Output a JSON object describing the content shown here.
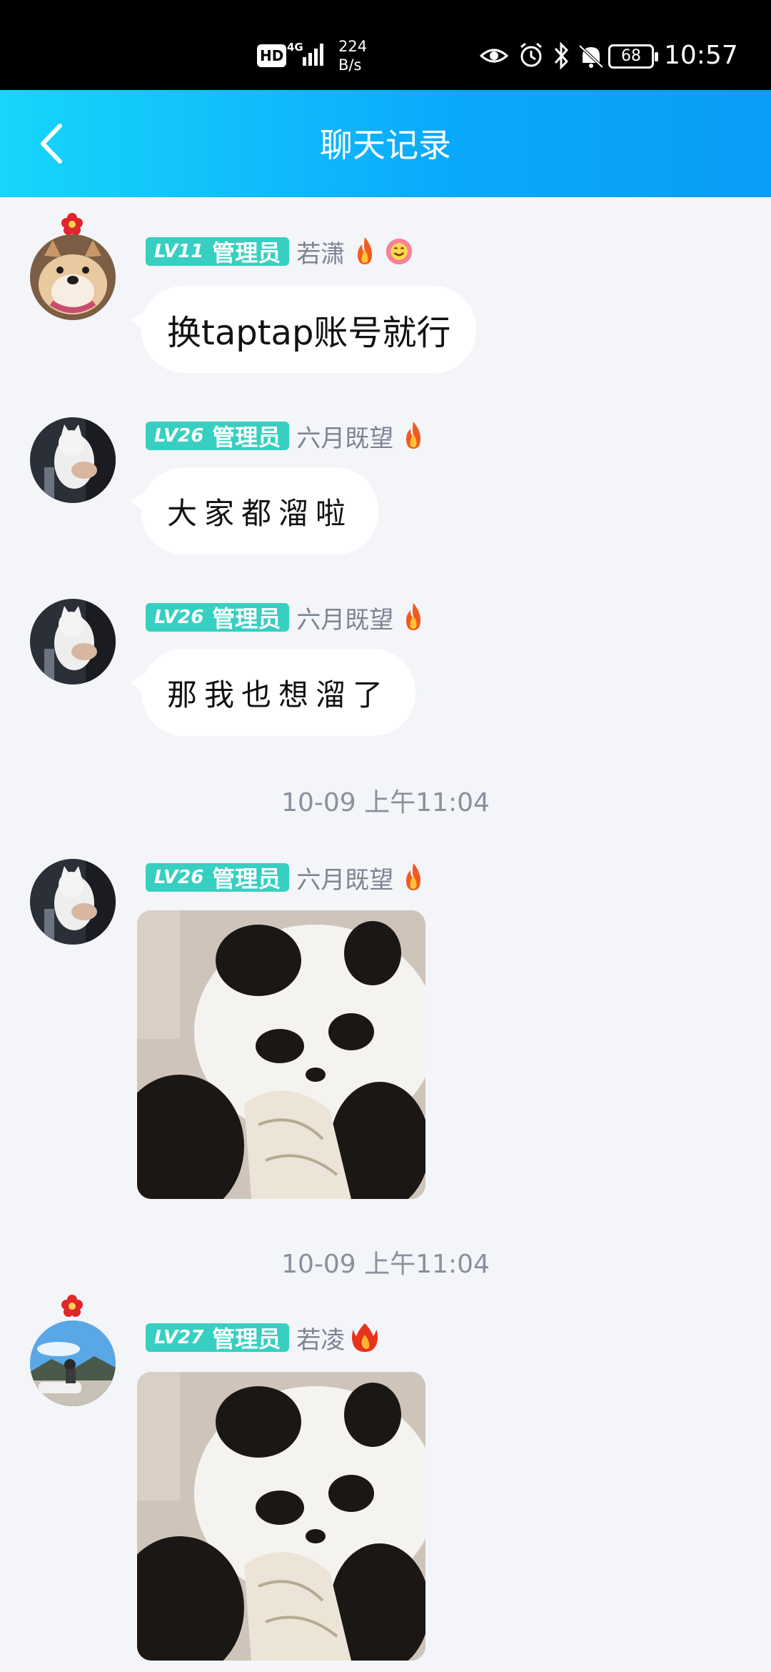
{
  "status_bar": {
    "hd_label": "HD",
    "network_label": "4G",
    "speed_value": "224",
    "speed_unit": "B/s",
    "battery_level": "68",
    "time": "10:57"
  },
  "header": {
    "title": "聊天记录",
    "back_icon": "chevron-left-icon"
  },
  "messages": [
    {
      "level": "LV11",
      "role": "管理员",
      "name": "若潇",
      "text": "换taptap账号就行"
    },
    {
      "level": "LV26",
      "role": "管理员",
      "name": "六月既望",
      "text": "大家都溜啦"
    },
    {
      "level": "LV26",
      "role": "管理员",
      "name": "六月既望",
      "text": "那我也想溜了"
    },
    {
      "timestamp": "10-09 上午11:04"
    },
    {
      "level": "LV26",
      "role": "管理员",
      "name": "六月既望",
      "image": "panda-sticker"
    },
    {
      "timestamp": "10-09 上午11:04"
    },
    {
      "level": "LV27",
      "role": "管理员",
      "name": "若凌",
      "image": "panda-sticker"
    }
  ],
  "colors": {
    "header_gradient_start": "#17d6fb",
    "header_gradient_end": "#0b9df7",
    "badge": "#37cfc1",
    "background": "#f3f5f9"
  }
}
